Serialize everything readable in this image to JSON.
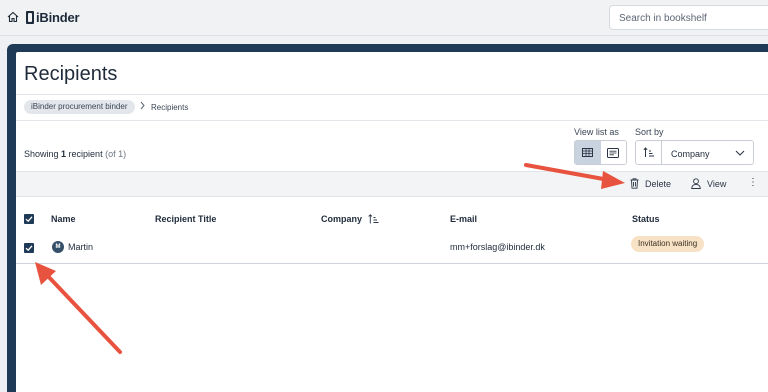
{
  "topbar": {
    "home_icon": "home-icon",
    "brand": "iBinder",
    "search_placeholder": "Search in bookshelf"
  },
  "page": {
    "title": "Recipients",
    "breadcrumb": [
      "iBinder procurement binder",
      "Recipients"
    ]
  },
  "summary": {
    "prefix": "Showing ",
    "count": "1",
    "noun": " recipient",
    "total": " (of 1)"
  },
  "controls": {
    "view_list_as_label": "View list as",
    "view_modes": [
      "table-view-icon",
      "list-view-icon"
    ],
    "sort_by_label": "Sort by",
    "sort_value": "Company"
  },
  "toolbar": {
    "delete_label": "Delete",
    "view_label": "View",
    "more_label": "⋮"
  },
  "table": {
    "columns": [
      "Name",
      "Recipient Title",
      "Company",
      "E-mail",
      "Status"
    ],
    "rows": [
      {
        "initial": "M",
        "name": "Martin",
        "title": "",
        "company": "",
        "email": "mm+forslag@ibinder.dk",
        "status": "Invitation waiting",
        "checked": true
      }
    ]
  },
  "colors": {
    "frame": "#1f3a56",
    "accent_check": "#1f3a56",
    "status_badge": "#f8e2c6",
    "annotation_arrow": "#e8533f"
  }
}
